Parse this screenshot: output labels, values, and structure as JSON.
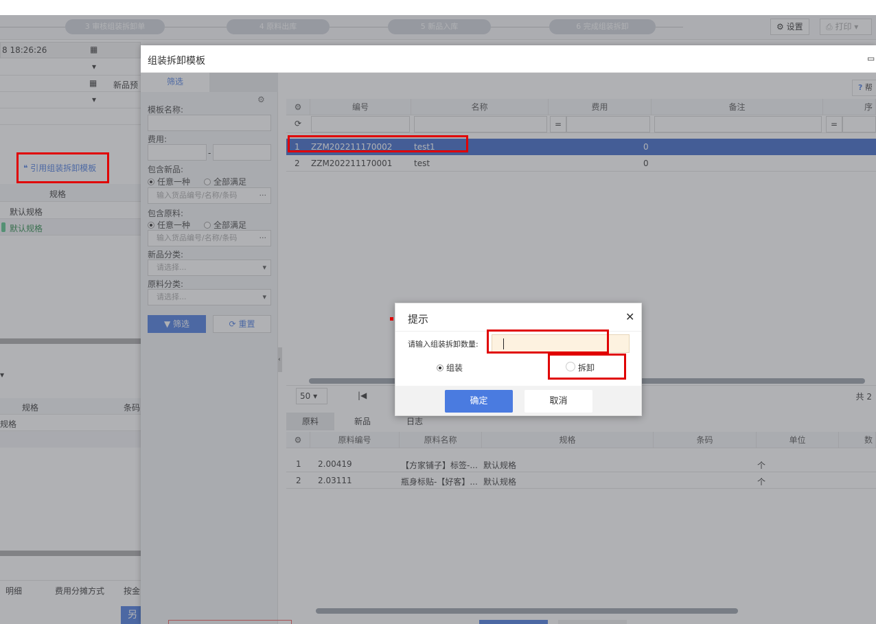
{
  "steps": [
    {
      "num": "3",
      "label": "审核组装拆卸单"
    },
    {
      "num": "4",
      "label": "原料出库"
    },
    {
      "num": "5",
      "label": "新品入库"
    },
    {
      "num": "6",
      "label": "完成组装拆卸"
    }
  ],
  "toolbar": {
    "settings_label": "设置",
    "print_label": "打印"
  },
  "left": {
    "datetime": "8 18:26:26",
    "new_preview_partial": "新品预",
    "ref_template_label": "引用组装拆卸模板",
    "spec_header": "规格",
    "spec_rows": [
      "默认规格",
      "默认规格"
    ],
    "lower_spec_header": "规格",
    "lower_barcode_header": "条码",
    "lower_spec_row": "规格",
    "bottom_tabs": [
      "明细",
      "费用分摊方式",
      "按金"
    ],
    "save_partial": "另"
  },
  "modal": {
    "title": "组装拆卸模板",
    "filter_tab": "筛选",
    "filter": {
      "template_name_label": "模板名称:",
      "fee_label": "费用:",
      "fee_sep": "-",
      "include_new_label": "包含新品:",
      "include_raw_label": "包含原料:",
      "opt_any": "任意一种",
      "opt_all": "全部满足",
      "goods_placeholder": "输入货品编号/名称/条码",
      "new_category_label": "新品分类:",
      "raw_category_label": "原料分类:",
      "select_placeholder": "请选择...",
      "filter_btn": "筛选",
      "reset_btn": "重置"
    },
    "help_label": "帮",
    "grid": {
      "headers": [
        "编号",
        "名称",
        "费用",
        "备注",
        "序"
      ],
      "rows": [
        {
          "idx": "1",
          "code": "ZZM202211170002",
          "name": "test1",
          "fee": "0"
        },
        {
          "idx": "2",
          "code": "ZZM202211170001",
          "name": "test",
          "fee": "0"
        }
      ],
      "page_size": "50",
      "total_partial": "共 2"
    },
    "bottom_tabs": [
      "原料",
      "新品",
      "日志"
    ],
    "detail": {
      "headers": [
        "原料编号",
        "原料名称",
        "规格",
        "条码",
        "单位",
        "数"
      ],
      "rows": [
        {
          "idx": "1",
          "code": "2.00419",
          "name": "【方家铺子】标签-...",
          "spec": "默认规格",
          "unit": "个"
        },
        {
          "idx": "2",
          "code": "2.03111",
          "name": "瓶身标贴-【好客】...",
          "spec": "默认规格",
          "unit": "个"
        }
      ]
    }
  },
  "dialog": {
    "title": "提示",
    "prompt_label": "请输入组装拆卸数量:",
    "quantity_value": "",
    "option_assemble": "组装",
    "option_disassemble": "拆卸",
    "confirm": "确定",
    "cancel": "取消"
  },
  "colors": {
    "accent": "#4a7be0",
    "highlight_row": "#3b67c9",
    "alert_red": "#e00000"
  }
}
